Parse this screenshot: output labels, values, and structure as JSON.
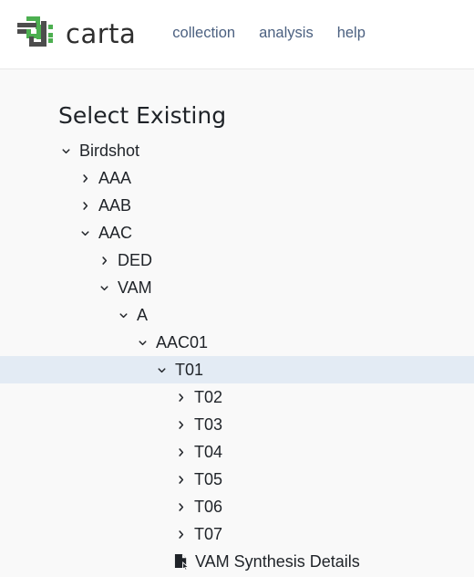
{
  "header": {
    "logo_icon": "carta-logo-icon",
    "brand_name": "carta",
    "brand_color_green": "#4caf50",
    "brand_color_gray": "#4d4d4d",
    "nav_link_color": "#4c6181",
    "nav": [
      {
        "label": "collection"
      },
      {
        "label": "analysis"
      },
      {
        "label": "help"
      }
    ]
  },
  "main": {
    "title": "Select Existing",
    "selected_row_color": "#e3ebf4",
    "tree": [
      {
        "label": "Birdshot",
        "depth": 0,
        "state": "expanded",
        "icon": "chevron-down-icon",
        "selected": false
      },
      {
        "label": "AAA",
        "depth": 1,
        "state": "collapsed",
        "icon": "chevron-right-icon",
        "selected": false
      },
      {
        "label": "AAB",
        "depth": 1,
        "state": "collapsed",
        "icon": "chevron-right-icon",
        "selected": false
      },
      {
        "label": "AAC",
        "depth": 1,
        "state": "expanded",
        "icon": "chevron-down-icon",
        "selected": false
      },
      {
        "label": "DED",
        "depth": 2,
        "state": "collapsed",
        "icon": "chevron-right-icon",
        "selected": false
      },
      {
        "label": "VAM",
        "depth": 2,
        "state": "expanded",
        "icon": "chevron-down-icon",
        "selected": false
      },
      {
        "label": "A",
        "depth": 3,
        "state": "expanded",
        "icon": "chevron-down-icon",
        "selected": false
      },
      {
        "label": "AAC01",
        "depth": 4,
        "state": "expanded",
        "icon": "chevron-down-icon",
        "selected": false
      },
      {
        "label": "T01",
        "depth": 5,
        "state": "expanded",
        "icon": "chevron-down-icon",
        "selected": true
      },
      {
        "label": "T02",
        "depth": 6,
        "state": "collapsed",
        "icon": "chevron-right-icon",
        "selected": false
      },
      {
        "label": "T03",
        "depth": 6,
        "state": "collapsed",
        "icon": "chevron-right-icon",
        "selected": false
      },
      {
        "label": "T04",
        "depth": 6,
        "state": "collapsed",
        "icon": "chevron-right-icon",
        "selected": false
      },
      {
        "label": "T05",
        "depth": 6,
        "state": "collapsed",
        "icon": "chevron-right-icon",
        "selected": false
      },
      {
        "label": "T06",
        "depth": 6,
        "state": "collapsed",
        "icon": "chevron-right-icon",
        "selected": false
      },
      {
        "label": "T07",
        "depth": 6,
        "state": "collapsed",
        "icon": "chevron-right-icon",
        "selected": false
      },
      {
        "label": "VAM Synthesis Details",
        "depth": 6,
        "state": "leaf",
        "icon": "file-document-icon",
        "selected": false
      }
    ]
  }
}
